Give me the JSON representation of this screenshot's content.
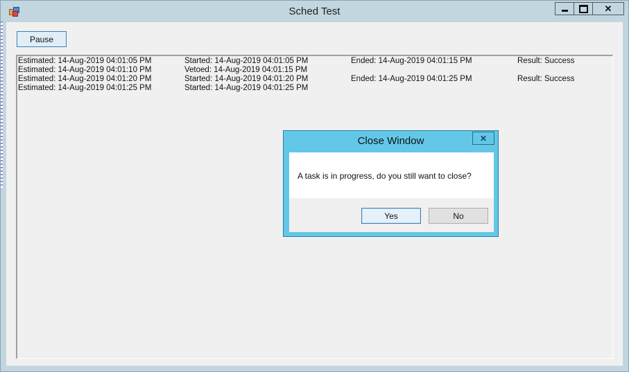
{
  "window": {
    "title": "Sched Test",
    "icon": "app-icon"
  },
  "toolbar": {
    "pause_label": "Pause"
  },
  "log": {
    "rows": [
      [
        "Estimated: 14-Aug-2019 04:01:05 PM",
        "Started: 14-Aug-2019 04:01:05 PM",
        "Ended: 14-Aug-2019 04:01:15 PM",
        "Result: Success"
      ],
      [
        "Estimated: 14-Aug-2019 04:01:10 PM",
        "Vetoed: 14-Aug-2019 04:01:15 PM",
        "",
        ""
      ],
      [
        "Estimated: 14-Aug-2019 04:01:20 PM",
        "Started: 14-Aug-2019 04:01:20 PM",
        "Ended: 14-Aug-2019 04:01:25 PM",
        "Result: Success"
      ],
      [
        "Estimated: 14-Aug-2019 04:01:25 PM",
        "Started: 14-Aug-2019 04:01:25 PM",
        "",
        ""
      ]
    ]
  },
  "dialog": {
    "title": "Close Window",
    "message": "A task is in progress, do you still want to close?",
    "yes_label": "Yes",
    "no_label": "No"
  },
  "colors": {
    "titlebar": "#c2d6e0",
    "dialog_accent": "#63c8e8",
    "button_focus": "#3c7fb1"
  }
}
